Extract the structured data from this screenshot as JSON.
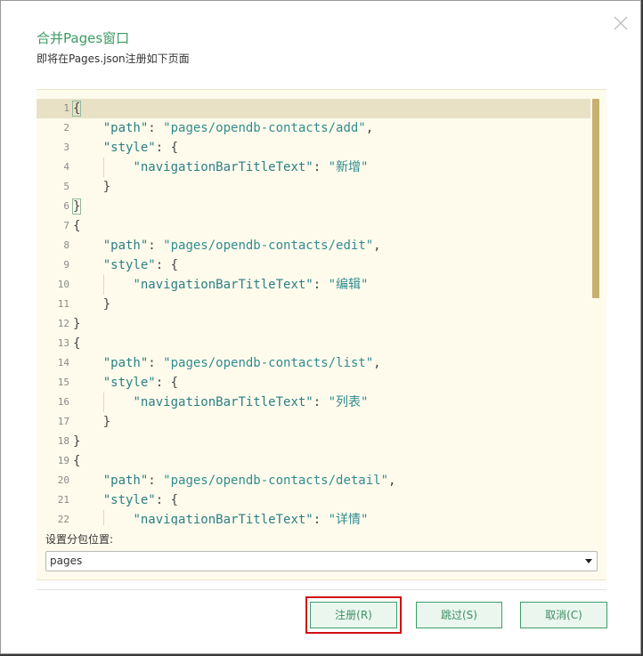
{
  "dialog": {
    "title": "合并Pages窗口",
    "subtitle": "即将在Pages.json注册如下页面",
    "close_icon": "close-icon"
  },
  "editor": {
    "lines": [
      {
        "n": "1",
        "tokens": [
          {
            "t": "{",
            "c": "punc bm"
          }
        ]
      },
      {
        "n": "2",
        "tokens": [
          {
            "t": "    "
          },
          {
            "t": "\"path\"",
            "c": "key"
          },
          {
            "t": ": ",
            "c": "punc"
          },
          {
            "t": "\"pages/opendb-contacts/add\"",
            "c": "str"
          },
          {
            "t": ",",
            "c": "punc"
          }
        ]
      },
      {
        "n": "3",
        "tokens": [
          {
            "t": "    "
          },
          {
            "t": "\"style\"",
            "c": "key"
          },
          {
            "t": ": {",
            "c": "punc"
          }
        ]
      },
      {
        "n": "4",
        "tokens": [
          {
            "t": "        "
          },
          {
            "t": "\"navigationBarTitleText\"",
            "c": "key"
          },
          {
            "t": ": ",
            "c": "punc"
          },
          {
            "t": "\"新增\"",
            "c": "str"
          }
        ]
      },
      {
        "n": "5",
        "tokens": [
          {
            "t": "    "
          },
          {
            "t": "}",
            "c": "punc"
          }
        ]
      },
      {
        "n": "6",
        "tokens": [
          {
            "t": "}",
            "c": "punc bm"
          }
        ]
      },
      {
        "n": "7",
        "tokens": [
          {
            "t": "{",
            "c": "punc"
          }
        ]
      },
      {
        "n": "8",
        "tokens": [
          {
            "t": "    "
          },
          {
            "t": "\"path\"",
            "c": "key"
          },
          {
            "t": ": ",
            "c": "punc"
          },
          {
            "t": "\"pages/opendb-contacts/edit\"",
            "c": "str"
          },
          {
            "t": ",",
            "c": "punc"
          }
        ]
      },
      {
        "n": "9",
        "tokens": [
          {
            "t": "    "
          },
          {
            "t": "\"style\"",
            "c": "key"
          },
          {
            "t": ": {",
            "c": "punc"
          }
        ]
      },
      {
        "n": "10",
        "tokens": [
          {
            "t": "        "
          },
          {
            "t": "\"navigationBarTitleText\"",
            "c": "key"
          },
          {
            "t": ": ",
            "c": "punc"
          },
          {
            "t": "\"编辑\"",
            "c": "str"
          }
        ]
      },
      {
        "n": "11",
        "tokens": [
          {
            "t": "    "
          },
          {
            "t": "}",
            "c": "punc"
          }
        ]
      },
      {
        "n": "12",
        "tokens": [
          {
            "t": "}",
            "c": "punc"
          }
        ]
      },
      {
        "n": "13",
        "tokens": [
          {
            "t": "{",
            "c": "punc"
          }
        ]
      },
      {
        "n": "14",
        "tokens": [
          {
            "t": "    "
          },
          {
            "t": "\"path\"",
            "c": "key"
          },
          {
            "t": ": ",
            "c": "punc"
          },
          {
            "t": "\"pages/opendb-contacts/list\"",
            "c": "str"
          },
          {
            "t": ",",
            "c": "punc"
          }
        ]
      },
      {
        "n": "15",
        "tokens": [
          {
            "t": "    "
          },
          {
            "t": "\"style\"",
            "c": "key"
          },
          {
            "t": ": {",
            "c": "punc"
          }
        ]
      },
      {
        "n": "16",
        "tokens": [
          {
            "t": "        "
          },
          {
            "t": "\"navigationBarTitleText\"",
            "c": "key"
          },
          {
            "t": ": ",
            "c": "punc"
          },
          {
            "t": "\"列表\"",
            "c": "str"
          }
        ]
      },
      {
        "n": "17",
        "tokens": [
          {
            "t": "    "
          },
          {
            "t": "}",
            "c": "punc"
          }
        ]
      },
      {
        "n": "18",
        "tokens": [
          {
            "t": "}",
            "c": "punc"
          }
        ]
      },
      {
        "n": "19",
        "tokens": [
          {
            "t": "{",
            "c": "punc"
          }
        ]
      },
      {
        "n": "20",
        "tokens": [
          {
            "t": "    "
          },
          {
            "t": "\"path\"",
            "c": "key"
          },
          {
            "t": ": ",
            "c": "punc"
          },
          {
            "t": "\"pages/opendb-contacts/detail\"",
            "c": "str"
          },
          {
            "t": ",",
            "c": "punc"
          }
        ]
      },
      {
        "n": "21",
        "tokens": [
          {
            "t": "    "
          },
          {
            "t": "\"style\"",
            "c": "key"
          },
          {
            "t": ": {",
            "c": "punc"
          }
        ]
      },
      {
        "n": "22",
        "tokens": [
          {
            "t": "        "
          },
          {
            "t": "\"navigationBarTitleText\"",
            "c": "key"
          },
          {
            "t": ": ",
            "c": "punc"
          },
          {
            "t": "\"详情\"",
            "c": "str"
          }
        ]
      }
    ]
  },
  "subpackage": {
    "label": "设置分包位置:",
    "selected": "pages"
  },
  "buttons": {
    "register": "注册(R)",
    "skip": "跳过(S)",
    "cancel": "取消(C)"
  },
  "colors": {
    "accent": "#3d9d69",
    "title": "#3c9b63",
    "editor_bg": "#fffbec",
    "highlight": "#d01010"
  }
}
